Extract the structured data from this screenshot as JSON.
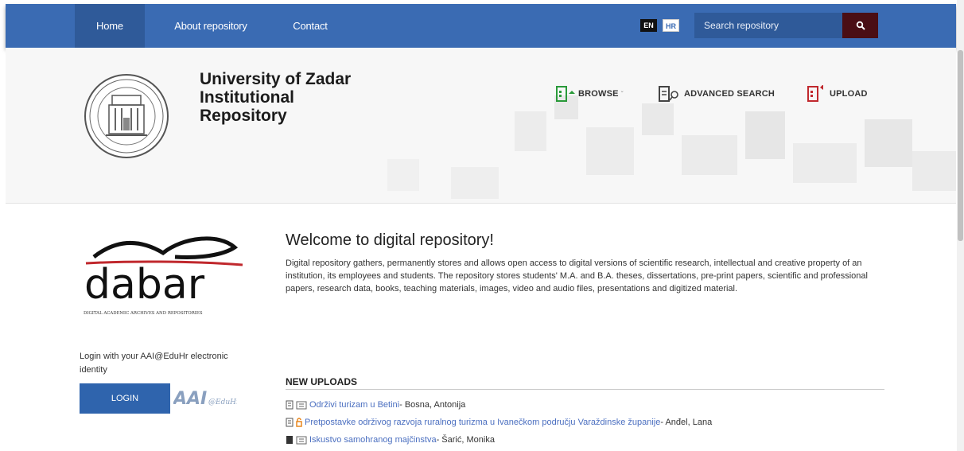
{
  "topnav": {
    "home": "Home",
    "about": "About repository",
    "contact": "Contact",
    "lang_en": "EN",
    "lang_hr": "HR",
    "search_placeholder": "Search repository"
  },
  "header": {
    "title_line1": "University of Zadar",
    "title_line2": "Institutional",
    "title_line3": "Repository",
    "browse": "BROWSE",
    "advanced_search": "ADVANCED SEARCH",
    "upload": "UPLOAD"
  },
  "sidebar": {
    "dabar_word": "dabar",
    "dabar_caption": "DIGITAL ACADEMIC ARCHIVES AND REPOSITORIES",
    "login_text": "Login with your AAI@EduHr electronic identity",
    "login_button": "LOGIN",
    "aai_logo_text": "AAI@EduHr"
  },
  "main": {
    "welcome_title": "Welcome to digital repository!",
    "welcome_text": "Digital repository gathers, permanently stores and allows open access to digital versions of scientific research, intellectual and creative property of an institution, its employees and students. The repository stores students' M.A. and B.A. theses, dissertations, pre-print papers, scientific and professional papers, research data, books, teaching materials, images, video and audio files, presentations and digitized material.",
    "new_uploads_heading": "NEW UPLOADS",
    "uploads": [
      {
        "title": "Održivi turizam u Betini",
        "author": " - Bosna, Antonija"
      },
      {
        "title": "Pretpostavke održivog razvoja ruralnog turizma u Ivanečkom području Varaždinske županije",
        "author": " - Anđel, Lana"
      },
      {
        "title": "Iskustvo samohranog majčinstva",
        "author": " - Šarić, Monika"
      }
    ]
  },
  "colors": {
    "nav_blue": "#3a6bb3",
    "nav_active": "#2f5a99",
    "search_button": "#4a0e14",
    "login_button": "#2f64ad",
    "link": "#4b6fc0",
    "accent_red": "#c0282d"
  }
}
